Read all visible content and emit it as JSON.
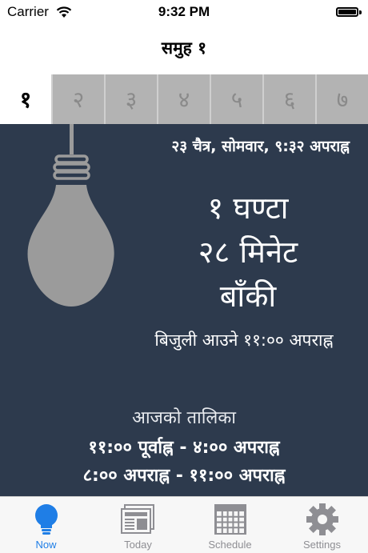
{
  "status_bar": {
    "carrier": "Carrier",
    "time": "9:32 PM"
  },
  "nav": {
    "title": "समुह १"
  },
  "group_tabs": [
    {
      "label": "१",
      "selected": true
    },
    {
      "label": "२",
      "selected": false
    },
    {
      "label": "३",
      "selected": false
    },
    {
      "label": "४",
      "selected": false
    },
    {
      "label": "५",
      "selected": false
    },
    {
      "label": "६",
      "selected": false
    },
    {
      "label": "७",
      "selected": false
    }
  ],
  "now": {
    "datetime": "२३ चैत्र, सोमवार, ९:३२ अपराह्न",
    "remaining_hours": "१ घण्टा",
    "remaining_minutes": "२८ मिनेट",
    "remaining_suffix": "बाँकी",
    "next_power": "बिजुली आउने ११:०० अपराह्न"
  },
  "schedule": {
    "title": "आजको तालिका",
    "rows": [
      "११:०० पूर्वाह्न  -  ४:०० अपराह्न",
      "८:०० अपराह्न  -  ११:०० अपराह्न"
    ]
  },
  "tabbar": {
    "items": [
      {
        "label": "Now",
        "icon": "bulb-icon",
        "active": true
      },
      {
        "label": "Today",
        "icon": "newspaper-icon",
        "active": false
      },
      {
        "label": "Schedule",
        "icon": "calendar-grid-icon",
        "active": false
      },
      {
        "label": "Settings",
        "icon": "gear-icon",
        "active": false
      }
    ]
  },
  "colors": {
    "panel_bg": "#2d3a4d",
    "bulb": "#9b9b9b",
    "tab_inactive": "#b3b3b3",
    "accent": "#1f7ee6"
  }
}
